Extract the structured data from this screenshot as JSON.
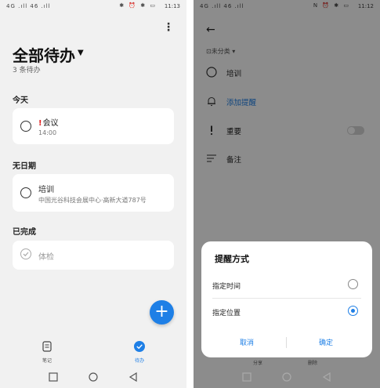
{
  "left": {
    "status": {
      "signal": "4G .ıll 46 .ıll",
      "icons": "✱ ⏰ ✱ ▭",
      "time": "11:13"
    },
    "title": "全部待办",
    "subtitle": "3 条待办",
    "sections": {
      "today": "今天",
      "no_date": "无日期",
      "done": "已完成"
    },
    "today_item": {
      "title": "会议",
      "time": "14:00",
      "flag": "!"
    },
    "nodate_item": {
      "title": "培训",
      "location": "中国光谷科技会展中心·高新大道787号"
    },
    "done_item": {
      "title": "体检"
    },
    "tabs": {
      "notes": "笔记",
      "todo": "待办"
    },
    "colors": {
      "accent": "#1e7fe6",
      "flag": "#e02020"
    }
  },
  "right": {
    "status": {
      "signal": "4G .ıll 46 .ıll",
      "icons": "N ⏰ ✱ ▭",
      "time": "11:12"
    },
    "folder": "未分类",
    "task_title": "培训",
    "add_reminder": "添加提醒",
    "important": "重要",
    "notes": "备注",
    "dialog": {
      "title": "提醒方式",
      "option_time": "指定时间",
      "option_location": "指定位置",
      "selected": "指定位置",
      "cancel": "取消",
      "confirm": "确定"
    },
    "behind": {
      "share": "分享",
      "delete": "删除"
    }
  }
}
